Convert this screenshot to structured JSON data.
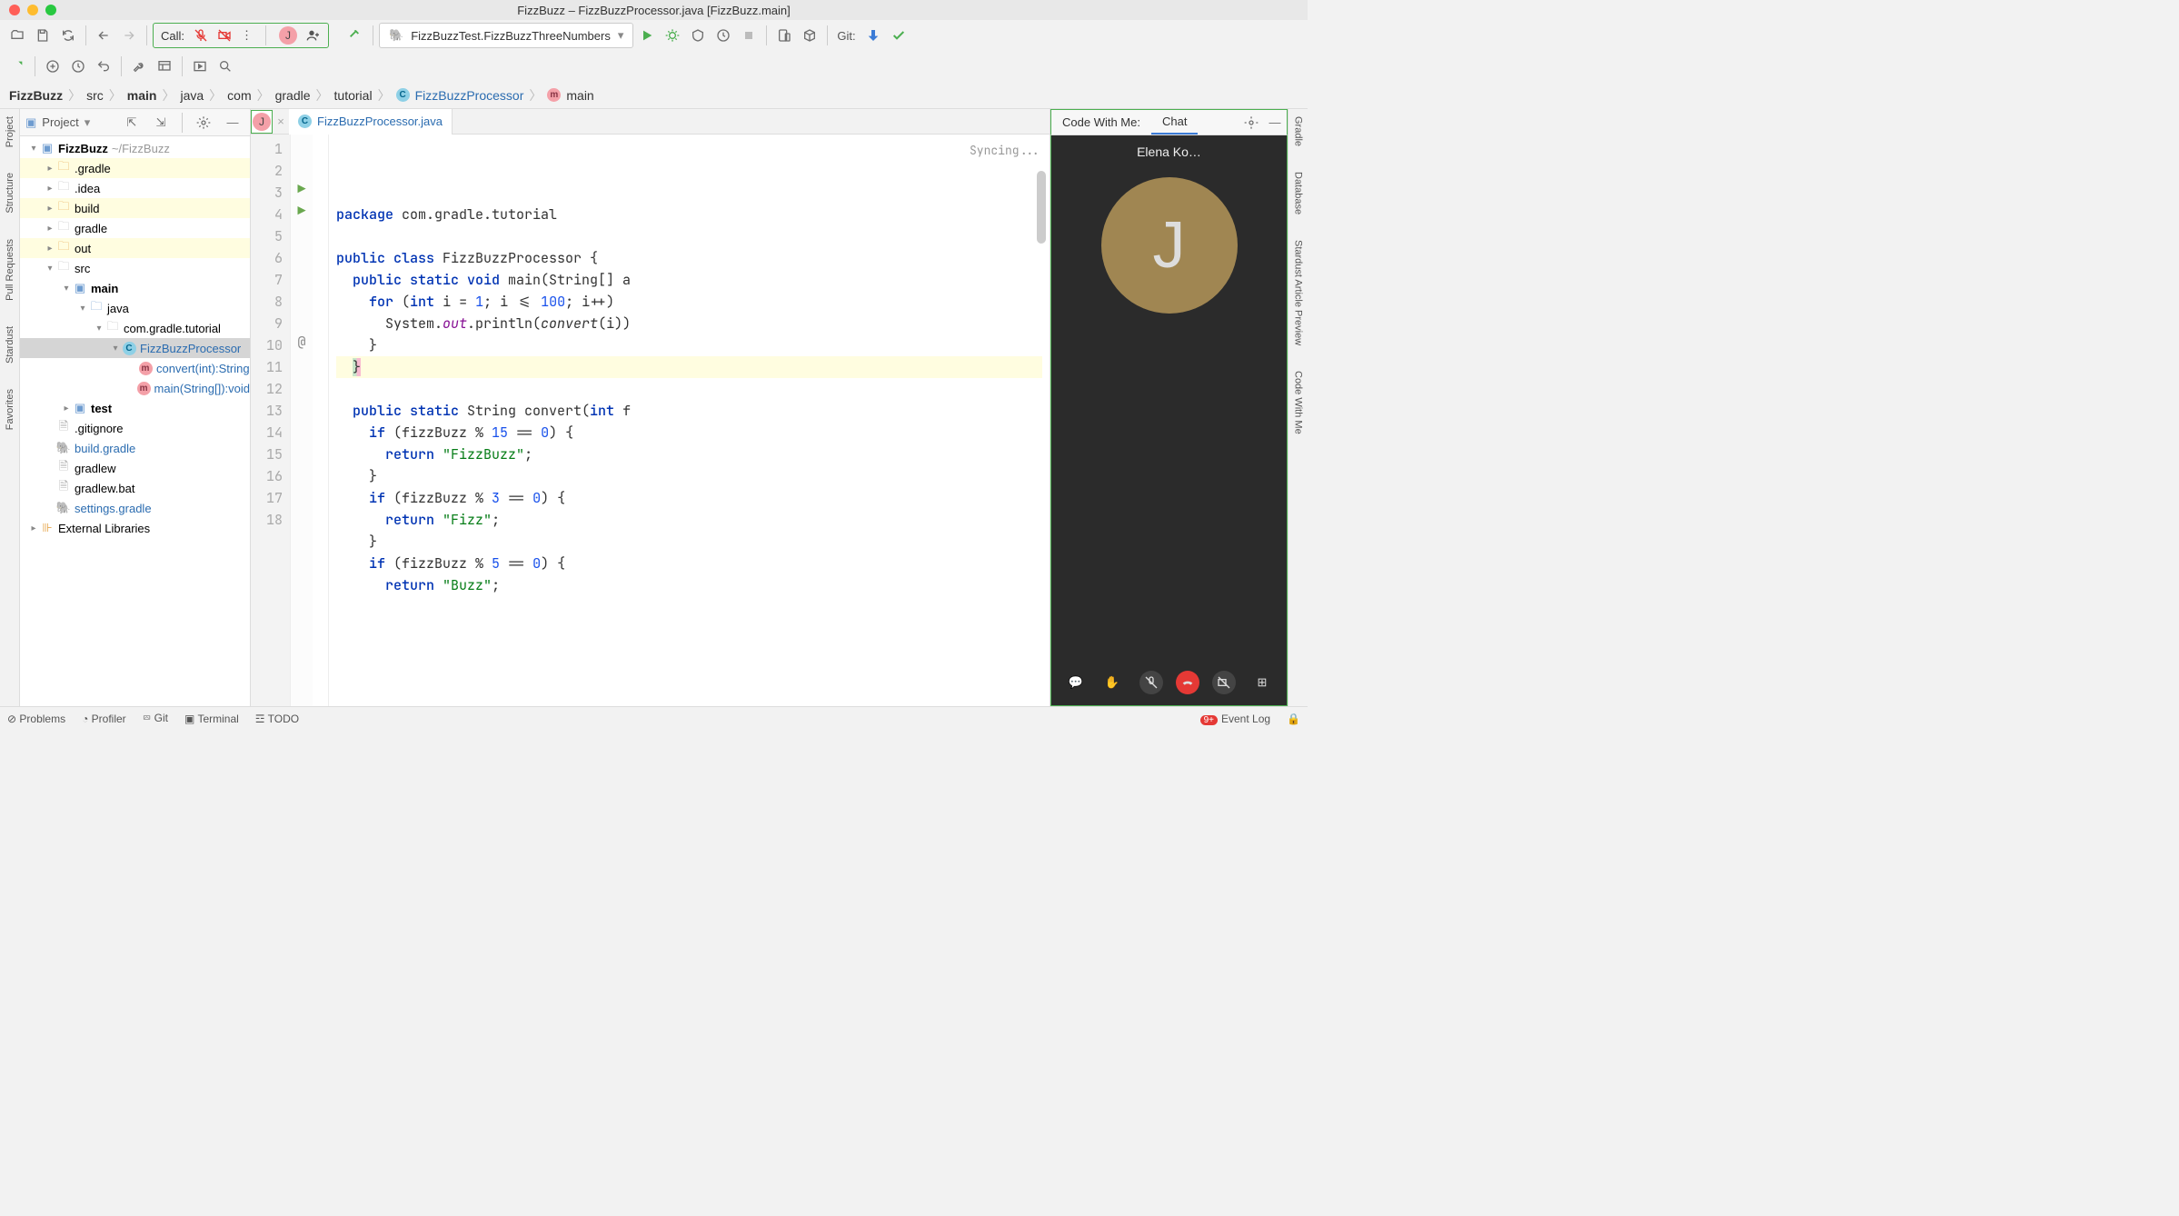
{
  "window_title": "FizzBuzz – FizzBuzzProcessor.java [FizzBuzz.main]",
  "toolbar": {
    "call_label": "Call:",
    "avatar_letter": "J",
    "run_config": "FizzBuzzTest.FizzBuzzThreeNumbers",
    "git_label": "Git:"
  },
  "breadcrumbs": [
    "FizzBuzz",
    "src",
    "main",
    "java",
    "com",
    "gradle",
    "tutorial",
    "FizzBuzzProcessor",
    "main"
  ],
  "sidebar_left": [
    "Project",
    "Structure",
    "Pull Requests",
    "Stardust",
    "Favorites"
  ],
  "sidebar_right": [
    "Gradle",
    "Database",
    "Stardust Article Preview",
    "Code With Me"
  ],
  "project_panel": {
    "title": "Project",
    "root_path": "~/FizzBuzz",
    "tree": [
      {
        "d": 0,
        "name": "FizzBuzz",
        "path": "~/FizzBuzz",
        "bold": true,
        "icon": "mod",
        "exp": true
      },
      {
        "d": 1,
        "name": ".gradle",
        "icon": "folder-o",
        "hl": true,
        "chev": true
      },
      {
        "d": 1,
        "name": ".idea",
        "icon": "folder",
        "chev": true
      },
      {
        "d": 1,
        "name": "build",
        "icon": "folder-o",
        "hl": true,
        "chev": true
      },
      {
        "d": 1,
        "name": "gradle",
        "icon": "folder",
        "chev": true
      },
      {
        "d": 1,
        "name": "out",
        "icon": "folder-o",
        "hl": true,
        "chev": true
      },
      {
        "d": 1,
        "name": "src",
        "icon": "folder",
        "exp": true
      },
      {
        "d": 2,
        "name": "main",
        "icon": "mod",
        "bold": true,
        "exp": true
      },
      {
        "d": 3,
        "name": "java",
        "icon": "src",
        "exp": true
      },
      {
        "d": 4,
        "name": "com.gradle.tutorial",
        "icon": "pkg",
        "exp": true
      },
      {
        "d": 5,
        "name": "FizzBuzzProcessor",
        "icon": "class",
        "blue": true,
        "sel": true,
        "exp": true
      },
      {
        "d": 6,
        "name": "convert(int):String",
        "icon": "method",
        "blue": true
      },
      {
        "d": 6,
        "name": "main(String[]):void",
        "icon": "method",
        "blue": true
      },
      {
        "d": 2,
        "name": "test",
        "icon": "mod",
        "bold": true,
        "chev": true
      },
      {
        "d": 1,
        "name": ".gitignore",
        "icon": "file"
      },
      {
        "d": 1,
        "name": "build.gradle",
        "icon": "gradle",
        "blue": true
      },
      {
        "d": 1,
        "name": "gradlew",
        "icon": "file"
      },
      {
        "d": 1,
        "name": "gradlew.bat",
        "icon": "file"
      },
      {
        "d": 1,
        "name": "settings.gradle",
        "icon": "gradle",
        "blue": true
      },
      {
        "d": 0,
        "name": "External Libraries",
        "icon": "lib",
        "chev": true
      }
    ]
  },
  "editor": {
    "tab_avatar": "J",
    "tab_name": "FizzBuzzProcessor.java",
    "sync_text": "Syncing...",
    "lines": [
      {
        "n": 1,
        "html": "<span class='kw'>package</span> com.gradle.tutorial"
      },
      {
        "n": 2,
        "html": ""
      },
      {
        "n": 3,
        "html": "<span class='kw'>public class</span> FizzBuzzProcessor {",
        "run": true
      },
      {
        "n": 4,
        "html": "  <span class='kw'>public static void</span> main(String[] a",
        "run": true
      },
      {
        "n": 5,
        "html": "    <span class='kw'>for</span> (<span class='kw'>int</span> i = <span class='num'>1</span>; i <= <span class='num'>100</span>; i++) "
      },
      {
        "n": 6,
        "html": "      System.<span class='fld'>out</span>.println(<span class='mtd'>convert</span>(i))"
      },
      {
        "n": 7,
        "html": "    }"
      },
      {
        "n": 8,
        "html": "  <span class='cursor-brace'>}</span>",
        "hl": true
      },
      {
        "n": 9,
        "html": ""
      },
      {
        "n": 10,
        "html": "  <span class='kw'>public static</span> String convert(<span class='kw'>int</span> f",
        "at": true
      },
      {
        "n": 11,
        "html": "    <span class='kw'>if</span> (fizzBuzz % <span class='num'>15</span> == <span class='num'>0</span>) {"
      },
      {
        "n": 12,
        "html": "      <span class='kw'>return</span> <span class='str'>\"FizzBuzz\"</span>;"
      },
      {
        "n": 13,
        "html": "    }"
      },
      {
        "n": 14,
        "html": "    <span class='kw'>if</span> (fizzBuzz % <span class='num'>3</span> == <span class='num'>0</span>) {"
      },
      {
        "n": 15,
        "html": "      <span class='kw'>return</span> <span class='str'>\"Fizz\"</span>;"
      },
      {
        "n": 16,
        "html": "    }"
      },
      {
        "n": 17,
        "html": "    <span class='kw'>if</span> (fizzBuzz % <span class='num'>5</span> == <span class='num'>0</span>) {"
      },
      {
        "n": 18,
        "html": "      <span class='kw'>return</span> <span class='str'>\"Buzz\"</span>;"
      }
    ]
  },
  "cwm": {
    "label": "Code With Me:",
    "tab_chat": "Chat",
    "caller": "Elena Ko…",
    "avatar_letter": "J"
  },
  "status": {
    "problems": "Problems",
    "profiler": "Profiler",
    "git": "Git",
    "terminal": "Terminal",
    "todo": "TODO",
    "event_log": "Event Log",
    "event_badge": "9+"
  }
}
